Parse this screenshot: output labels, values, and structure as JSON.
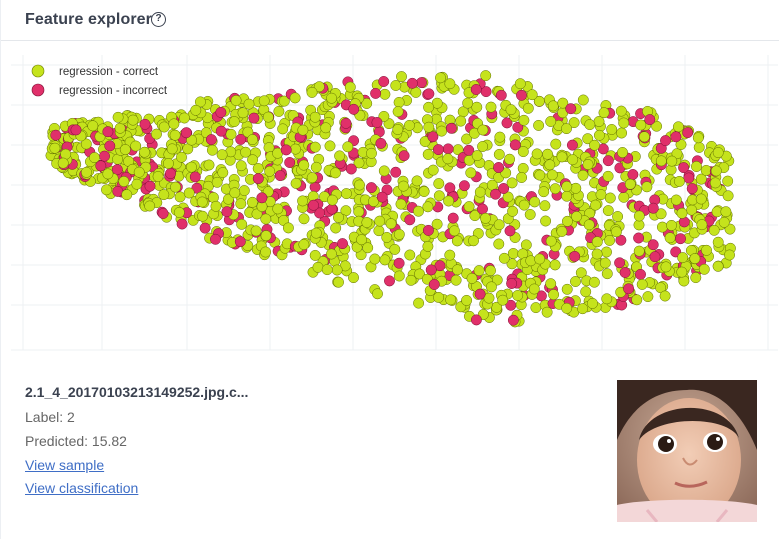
{
  "header": {
    "title": "Feature explorer",
    "help_icon": "question-circle-icon"
  },
  "legend": {
    "correct_label": "regression - correct",
    "incorrect_label": "regression - incorrect"
  },
  "colors": {
    "correct": "#c5e31c",
    "incorrect": "#e0306a",
    "link": "#3f6ec6"
  },
  "details": {
    "file_name": "2.1_4_20170103213149252.jpg.c...",
    "label_text": "Label: 2",
    "predicted_text": "Predicted: 15.82",
    "view_sample": "View sample",
    "view_classification": "View classification"
  },
  "thumbnail": {
    "icon": "face-photo-thumbnail"
  }
}
